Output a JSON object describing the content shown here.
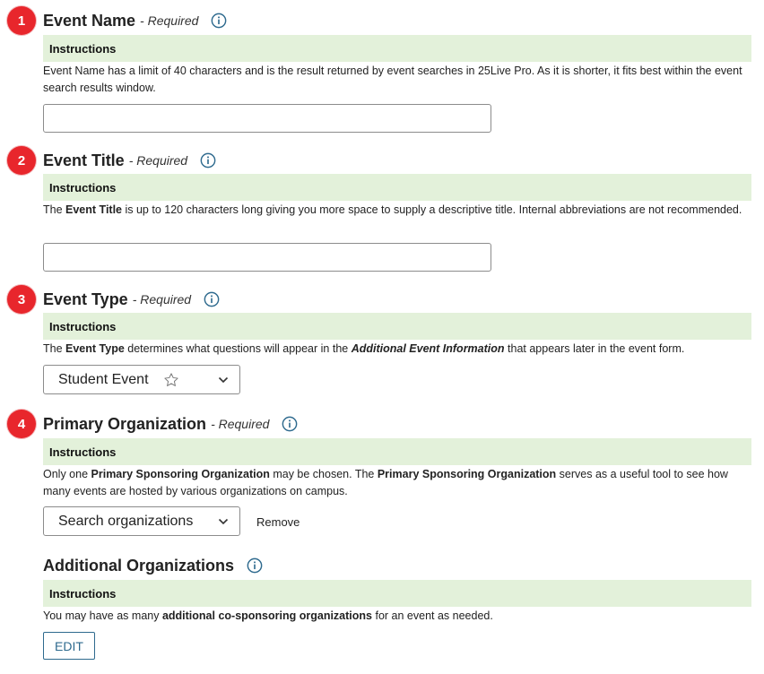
{
  "sections": [
    {
      "number": "1",
      "title": "Event Name",
      "required": "- Required",
      "instructions_header": "Instructions",
      "instructions": "Event Name has a limit of 40 characters and is the result returned by event searches in 25Live Pro.  As it is shorter, it fits best within the event search results window.",
      "input_value": ""
    },
    {
      "number": "2",
      "title": "Event Title",
      "required": "- Required",
      "instructions_header": "Instructions",
      "instructions_parts": [
        "The ",
        "Event Title",
        " is up to 120 characters long giving you more space to supply a descriptive title.  Internal abbreviations are not recommended."
      ],
      "input_value": ""
    },
    {
      "number": "3",
      "title": "Event Type",
      "required": "- Required",
      "instructions_header": "Instructions",
      "instructions_parts": [
        "The ",
        "Event Type",
        " determines what questions will appear in the ",
        "Additional Event Information",
        " that appears later in the event form."
      ],
      "select_value": "Student Event"
    },
    {
      "number": "4",
      "title": "Primary Organization",
      "required": "- Required",
      "instructions_header": "Instructions",
      "instructions_parts": [
        "Only one ",
        "Primary Sponsoring Organization",
        " may be chosen.  The ",
        "Primary Sponsoring Organization",
        " serves as a useful tool to see how many events are hosted by various organizations on campus."
      ],
      "select_value": "Search organizations",
      "remove_label": "Remove"
    },
    {
      "title": "Additional Organizations",
      "instructions_header": "Instructions",
      "instructions_parts": [
        "You may have as many ",
        "additional co-sponsoring organizations",
        " for an event as needed."
      ],
      "edit_label": "EDIT"
    }
  ],
  "icons": {
    "info": "info-circle-icon",
    "star": "star-outline-icon",
    "chevron": "chevron-down-icon"
  },
  "colors": {
    "badge": "#e8262c",
    "instructions_bg": "#e3f1da",
    "accent": "#2e6a8e"
  }
}
